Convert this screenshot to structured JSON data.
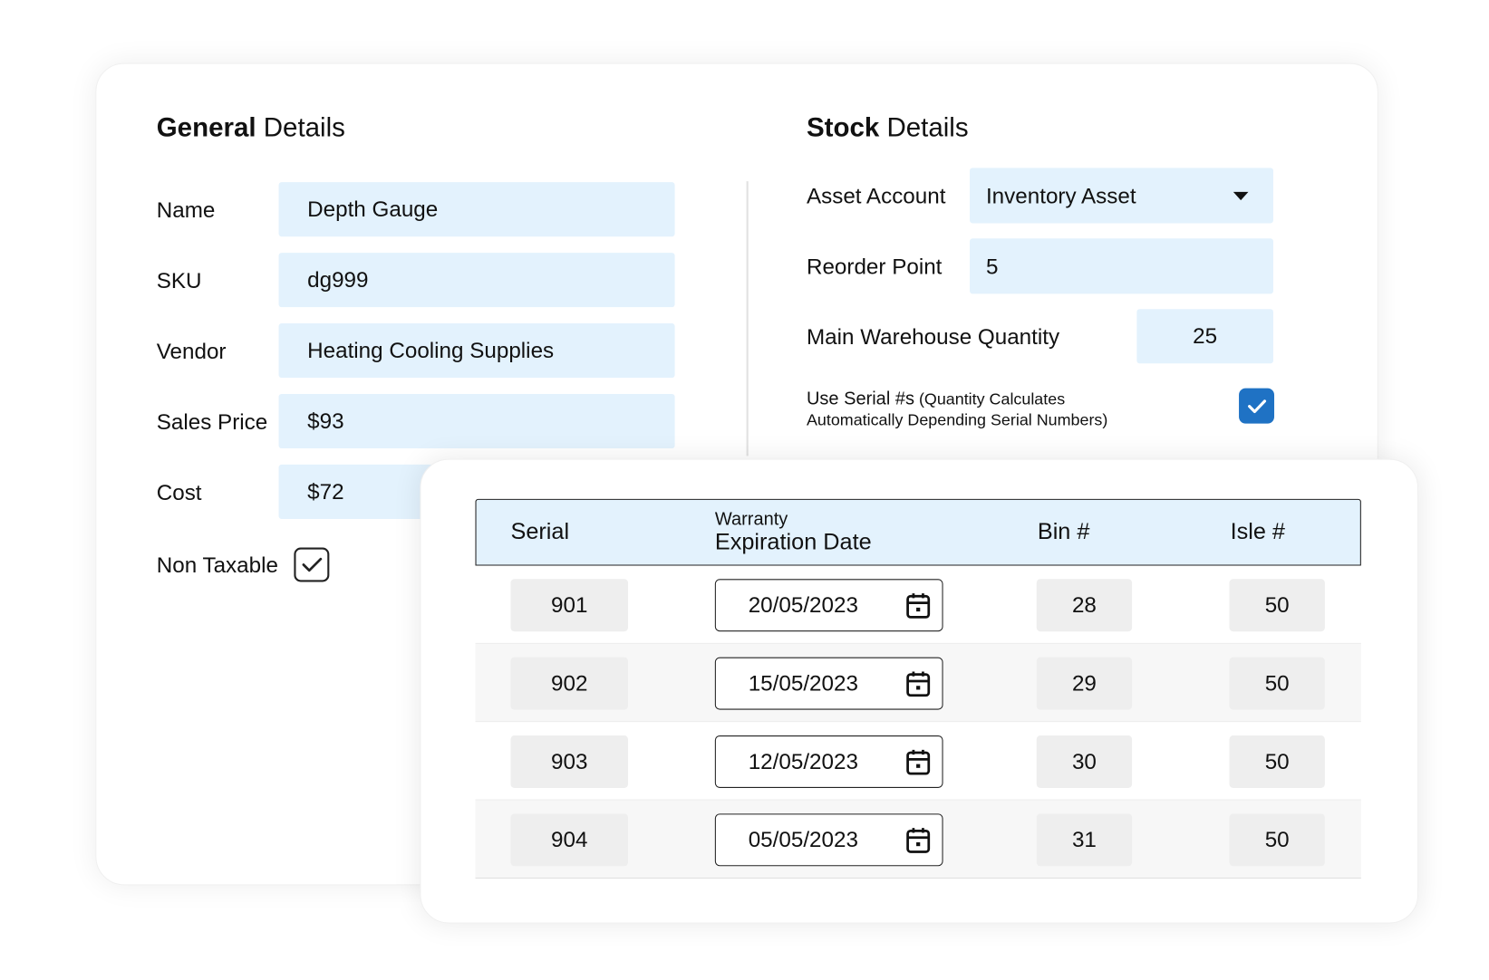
{
  "general": {
    "title_bold": "General",
    "title_rest": " Details",
    "fields": [
      {
        "label": "Name",
        "value": "Depth Gauge"
      },
      {
        "label": "SKU",
        "value": "dg999"
      },
      {
        "label": "Vendor",
        "value": "Heating Cooling Supplies"
      },
      {
        "label": "Sales Price",
        "value": "$93"
      },
      {
        "label": "Cost",
        "value": "$72"
      }
    ],
    "non_taxable": {
      "label": "Non Taxable",
      "checked": true
    }
  },
  "stock": {
    "title_bold": "Stock",
    "title_rest": " Details",
    "asset_account": {
      "label": "Asset Account",
      "value": "Inventory Asset"
    },
    "reorder_point": {
      "label": "Reorder Point",
      "value": "5"
    },
    "main_warehouse": {
      "label": "Main Warehouse Quantity",
      "value": "25"
    },
    "use_serial": {
      "label": "Use Serial #s",
      "note_line1": " (Quantity Calculates",
      "note_line2": "Automatically Depending Serial Numbers)",
      "checked": true
    }
  },
  "table": {
    "headers": {
      "serial": "Serial",
      "warranty_top": "Warranty",
      "warranty_bottom": "Expiration Date",
      "bin": "Bin #",
      "isle": "Isle #"
    },
    "rows": [
      {
        "serial": "901",
        "date": "20/05/2023",
        "bin": "28",
        "isle": "50"
      },
      {
        "serial": "902",
        "date": "15/05/2023",
        "bin": "29",
        "isle": "50"
      },
      {
        "serial": "903",
        "date": "12/05/2023",
        "bin": "30",
        "isle": "50"
      },
      {
        "serial": "904",
        "date": "05/05/2023",
        "bin": "31",
        "isle": "50"
      }
    ]
  },
  "colors": {
    "field_bg": "#e3f2fd",
    "accent": "#1f72c4",
    "cell_bg": "#eeeeee"
  }
}
